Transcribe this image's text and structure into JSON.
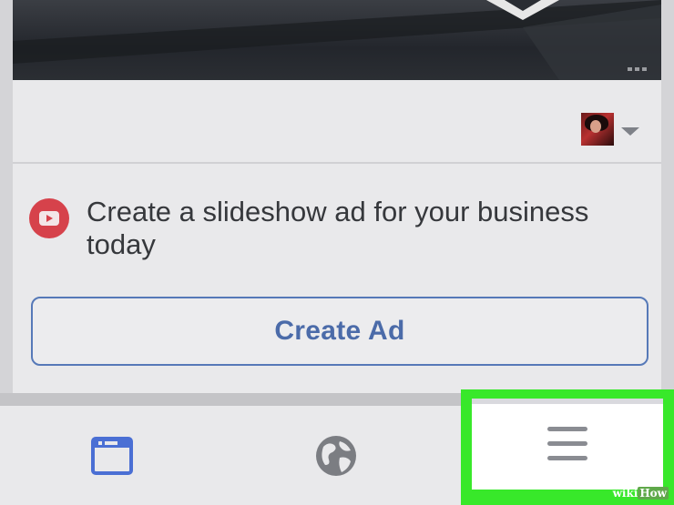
{
  "post": {
    "ad_prompt": "Create a slideshow ad for your business today",
    "create_ad_label": "Create Ad"
  },
  "icons": {
    "play": "youtube-play-icon",
    "caret": "caret-down-icon",
    "news_feed": "news-feed-icon",
    "globe": "globe-icon",
    "menu": "hamburger-menu-icon"
  },
  "colors": {
    "accent": "#4b6ba9",
    "news_feed_icon": "#4a6fd4",
    "youtube_red": "#d6424b",
    "highlight": "#38e82a"
  },
  "watermark": {
    "prefix": "wiki",
    "suffix": "How"
  }
}
